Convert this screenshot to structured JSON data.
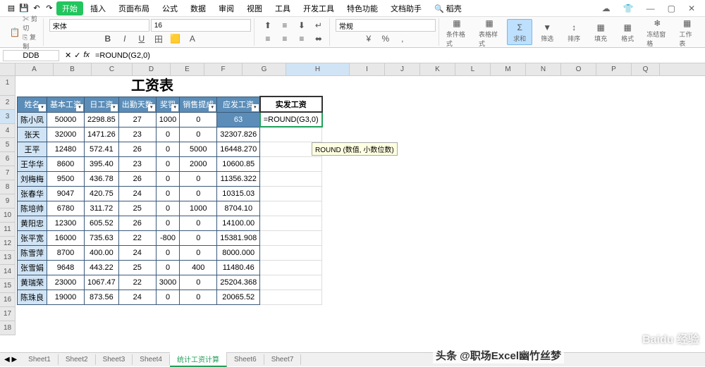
{
  "menu": {
    "items": [
      "",
      "",
      "插入",
      "页面布局",
      "公式",
      "数据",
      "审阅",
      "视图",
      "工具",
      "开发工具",
      "特色功能",
      "文档助手"
    ],
    "activeIndex": 1,
    "activeLabel": "开始",
    "search": "稻壳"
  },
  "ribbon": {
    "clipboard": {
      "cut": "剪切",
      "copy": "复制"
    },
    "font": {
      "family": "宋体",
      "size": "16"
    },
    "align": {
      "name": "常规"
    },
    "labels": [
      "条件格式",
      "表格样式",
      "求和",
      "筛选",
      "排序",
      "填充",
      "格式",
      "冻结窗格",
      "工作表"
    ]
  },
  "formulaBar": {
    "name": "DDB",
    "formula": "=ROUND(G2,0)"
  },
  "columns": [
    "A",
    "B",
    "C",
    "D",
    "E",
    "F",
    "G",
    "H",
    "I",
    "J",
    "K",
    "L",
    "M",
    "N",
    "O",
    "P",
    "Q"
  ],
  "rowCount": 18,
  "title": "工资表",
  "headers": [
    "姓名",
    "基本工资",
    "日工资",
    "出勤天数",
    "奖罚",
    "销售提成",
    "应发工资"
  ],
  "extraHeader": "实发工资",
  "activeFormula": "=ROUND(G3,0)",
  "tooltip": "ROUND (数值, 小数位数)",
  "rows": [
    {
      "n": "陈小凤",
      "a": "50000",
      "b": "2298.85",
      "c": "27",
      "d": "1000",
      "e": "0",
      "f": "",
      "g": ""
    },
    {
      "n": "张天",
      "a": "32000",
      "b": "1471.26",
      "c": "23",
      "d": "0",
      "e": "0",
      "f": "32307.826",
      "g": ""
    },
    {
      "n": "王平",
      "a": "12480",
      "b": "572.41",
      "c": "26",
      "d": "0",
      "e": "5000",
      "f": "16448.270",
      "g": ""
    },
    {
      "n": "王华华",
      "a": "8600",
      "b": "395.40",
      "c": "23",
      "d": "0",
      "e": "2000",
      "f": "10600.85",
      "g": ""
    },
    {
      "n": "刘梅梅",
      "a": "9500",
      "b": "436.78",
      "c": "26",
      "d": "0",
      "e": "0",
      "f": "11356.322",
      "g": ""
    },
    {
      "n": "张春华",
      "a": "9047",
      "b": "420.75",
      "c": "24",
      "d": "0",
      "e": "0",
      "f": "10315.03",
      "g": ""
    },
    {
      "n": "陈培帅",
      "a": "6780",
      "b": "311.72",
      "c": "25",
      "d": "0",
      "e": "1000",
      "f": "8704.10",
      "g": ""
    },
    {
      "n": "黄阳忠",
      "a": "12300",
      "b": "605.52",
      "c": "26",
      "d": "0",
      "e": "0",
      "f": "14100.00",
      "g": ""
    },
    {
      "n": "张平宽",
      "a": "16000",
      "b": "735.63",
      "c": "22",
      "d": "-800",
      "e": "0",
      "f": "15381.908",
      "g": ""
    },
    {
      "n": "陈雪萍",
      "a": "8700",
      "b": "400.00",
      "c": "24",
      "d": "0",
      "e": "0",
      "f": "8000.000",
      "g": ""
    },
    {
      "n": "张雪娟",
      "a": "9648",
      "b": "443.22",
      "c": "25",
      "d": "0",
      "e": "400",
      "f": "11480.46",
      "g": ""
    },
    {
      "n": "黄瑞荣",
      "a": "23000",
      "b": "1067.47",
      "c": "22",
      "d": "3000",
      "e": "0",
      "f": "25204.368",
      "g": ""
    },
    {
      "n": "陈珠良",
      "a": "19000",
      "b": "873.56",
      "c": "24",
      "d": "0",
      "e": "0",
      "f": "20065.52",
      "g": ""
    }
  ],
  "sheets": [
    "Sheet1",
    "Sheet2",
    "Sheet3",
    "Sheet4",
    "统计工资计算",
    "Sheet6",
    "Sheet7"
  ],
  "activeSheet": 4,
  "watermark1": "Baidu 经验",
  "watermark2": "头条 @职场Excel幽竹丝梦"
}
